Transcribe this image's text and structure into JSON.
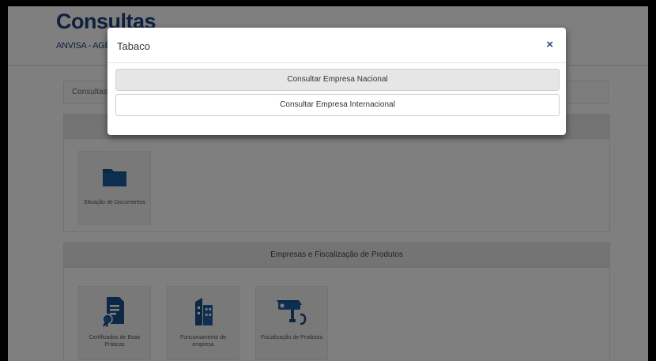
{
  "page": {
    "title": "Consultas",
    "subtitle": "ANVISA - AGÊNCIA NACIONAL DE VIGILÂNCIA SANITÁRIA"
  },
  "breadcrumb": {
    "text": "Consultas"
  },
  "panels": [
    {
      "header": "",
      "tiles": [
        {
          "label": "Situação de Documentos",
          "icon": "folder-icon"
        }
      ]
    },
    {
      "header": "Empresas e Fiscalização de Produtos",
      "tiles": [
        {
          "label": "Certificados de Boas Práticas",
          "icon": "certificate-icon"
        },
        {
          "label": "Funcionamento de empresa",
          "icon": "building-icon"
        },
        {
          "label": "Fiscalização de Produtos",
          "icon": "camera-icon"
        }
      ]
    }
  ],
  "modal": {
    "title": "Tabaco",
    "close_glyph": "×",
    "options": [
      {
        "label": "Consultar Empresa Nacional"
      },
      {
        "label": "Consultar Empresa Internacional"
      }
    ]
  },
  "colors": {
    "brand_blue": "#1f3e7c",
    "icon_blue": "#1a4e8a",
    "overlay": "rgba(0,0,0,0.5)"
  }
}
